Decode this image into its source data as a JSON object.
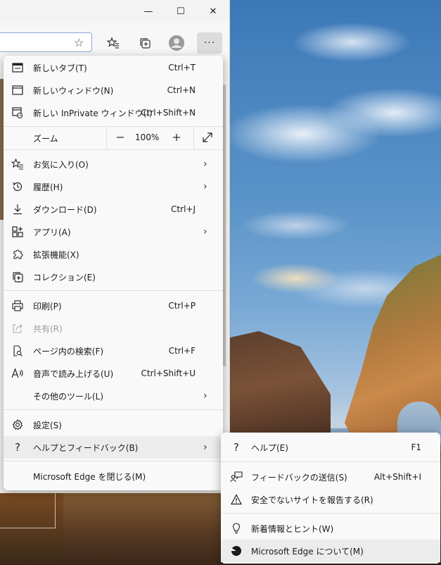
{
  "window": {
    "controls": {
      "minimize": "—",
      "maximize": "☐",
      "close": "✕"
    }
  },
  "toolbar": {
    "favorite_star": "☆",
    "favorites": "✩",
    "collections": "⧉",
    "more": "···"
  },
  "menu": {
    "new_tab": {
      "label": "新しいタブ(T)",
      "shortcut": "Ctrl+T"
    },
    "new_window": {
      "label": "新しいウィンドウ(N)",
      "shortcut": "Ctrl+N"
    },
    "new_inprivate": {
      "label": "新しい InPrivate ウィンドウ(I)",
      "shortcut": "Ctrl+Shift+N"
    },
    "zoom": {
      "label": "ズーム",
      "minus": "—",
      "value": "100%",
      "plus": "+",
      "fullscreen": "⤢"
    },
    "favorites": {
      "label": "お気に入り(O)"
    },
    "history": {
      "label": "履歴(H)"
    },
    "downloads": {
      "label": "ダウンロード(D)",
      "shortcut": "Ctrl+J"
    },
    "apps": {
      "label": "アプリ(A)"
    },
    "extensions": {
      "label": "拡張機能(X)"
    },
    "collections": {
      "label": "コレクション(E)"
    },
    "print": {
      "label": "印刷(P)",
      "shortcut": "Ctrl+P"
    },
    "share": {
      "label": "共有(R)"
    },
    "find": {
      "label": "ページ内の検索(F)",
      "shortcut": "Ctrl+F"
    },
    "read_aloud": {
      "label": "音声で読み上げる(U)",
      "shortcut": "Ctrl+Shift+U"
    },
    "more_tools": {
      "label": "その他のツール(L)"
    },
    "settings": {
      "label": "設定(S)"
    },
    "help_feedback": {
      "label": "ヘルプとフィードバック(B)"
    },
    "close_edge": {
      "label": "Microsoft Edge を閉じる(M)"
    }
  },
  "submenu": {
    "help": {
      "label": "ヘルプ(E)",
      "shortcut": "F1"
    },
    "send_feedback": {
      "label": "フィードバックの送信(S)",
      "shortcut": "Alt+Shift+I"
    },
    "report_unsafe": {
      "label": "安全でないサイトを報告する(R)"
    },
    "whats_new": {
      "label": "新着情報とヒント(W)"
    },
    "about": {
      "label": "Microsoft Edge について(M)"
    }
  },
  "icons": {
    "arrow": "›",
    "question": "?"
  }
}
